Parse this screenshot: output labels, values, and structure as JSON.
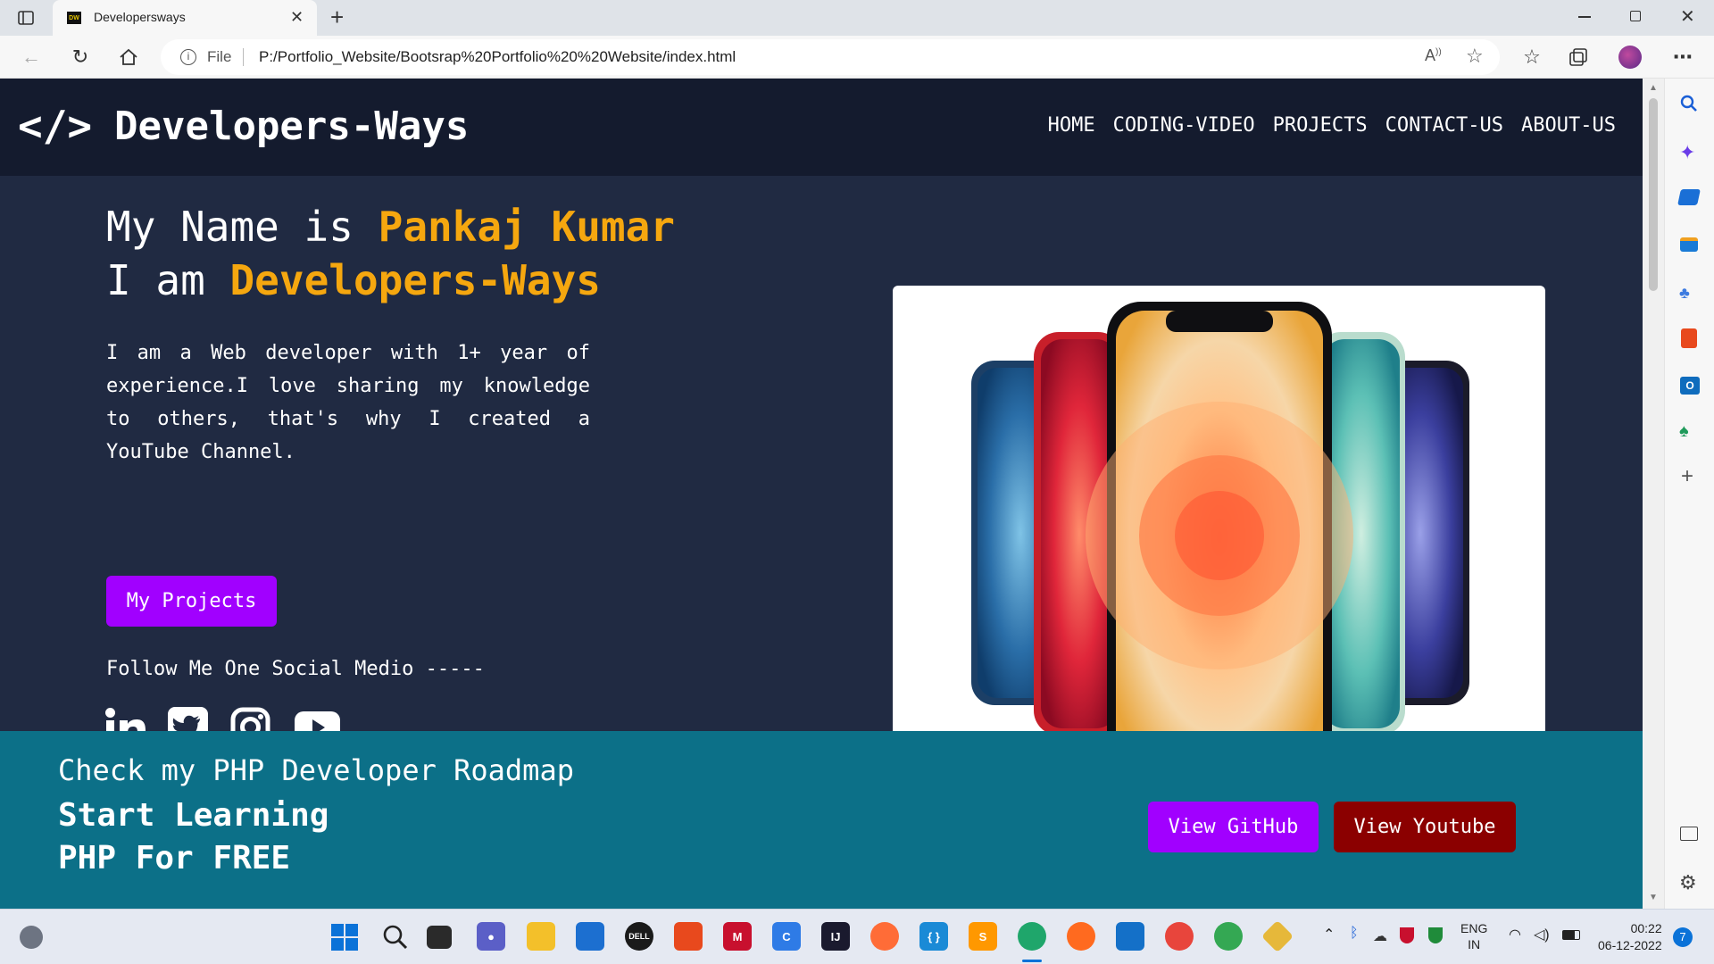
{
  "browser": {
    "tab_title": "Developersways",
    "tab_favicon_text": "DW",
    "address_prefix": "File",
    "address_url": "P:/Portfolio_Website/Bootsrap%20Portfolio%20%20Website/index.html",
    "new_tab_label": "+"
  },
  "nav": {
    "logo_symbol": "</>",
    "brand": "Developers-Ways",
    "links": [
      "HOME",
      "CODING-VIDEO",
      "PROJECTS",
      "CONTACT-US",
      "ABOUT-US"
    ]
  },
  "hero": {
    "line1_prefix": "My Name is",
    "line1_name": "Pankaj Kumar",
    "line2_prefix": "I am",
    "line2_name": "Developers-Ways",
    "bio": "I am a Web developer with 1+ year of experience.I love sharing my knowledge to others, that's why I created a YouTube Channel.",
    "cta": "My Projects",
    "follow": "Follow Me One Social Medio -----",
    "social_icons": [
      "linkedin-icon",
      "twitter-icon",
      "instagram-icon",
      "youtube-icon"
    ]
  },
  "promo": {
    "line1": "Check my PHP Developer Roadmap",
    "line2": "Start Learning",
    "line3": "PHP For FREE",
    "github_button": "View GitHub",
    "youtube_button": "View Youtube"
  },
  "taskbar": {
    "lang_top": "ENG",
    "lang_bottom": "IN",
    "time": "00:22",
    "date": "06-12-2022",
    "notifications": "7"
  },
  "colors": {
    "accent_orange": "#f5a70f",
    "purple": "#a100ff",
    "dark_red": "#8b0000",
    "nav_bg": "#141b2e",
    "hero_bg": "#202a42",
    "promo_bg": "#0c7088"
  }
}
